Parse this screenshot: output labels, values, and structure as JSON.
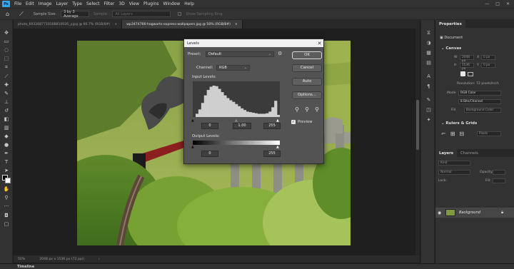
{
  "app": {
    "logo_text": "Ps"
  },
  "menu": [
    "File",
    "Edit",
    "Image",
    "Layer",
    "Type",
    "Select",
    "Filter",
    "3D",
    "View",
    "Plugins",
    "Window",
    "Help"
  ],
  "window_controls": [
    "—",
    "□",
    "✕"
  ],
  "options_bar": {
    "sample_size_label": "Sample Size:",
    "sample_size_value": "3 by 3 Average",
    "sample_label": "Sample:",
    "sample_value": "All Layers",
    "show_ring_label": "Show Sampling Ring"
  },
  "document_tabs": [
    {
      "title": "photo_6032687710188810026_y.jpg @ 66.7% (RGB/8#)",
      "close": "×",
      "active": false
    },
    {
      "title": "wp3474766-hogwarts-express-wallpapers.jpg @ 50% (RGB/8#)",
      "close": "×",
      "active": true
    }
  ],
  "status_bar": {
    "zoom": "50%",
    "doc_info": "2048 px x 1536 px (72 ppi)",
    "arrow": "›"
  },
  "timeline": {
    "label": "Timeline"
  },
  "levels": {
    "title": "Levels",
    "close": "✕",
    "preset_label": "Preset:",
    "preset_value": "Default",
    "channel_label": "Channel:",
    "channel_value": "RGB",
    "input_levels_label": "Input Levels:",
    "input_black": "0",
    "input_gamma": "1.00",
    "input_white": "255",
    "output_levels_label": "Output Levels:",
    "output_black": "0",
    "output_white": "255",
    "buttons": {
      "ok": "OK",
      "cancel": "Cancel",
      "auto": "Auto",
      "options": "Options..."
    },
    "preview_label": "Preview",
    "preview_checked": true
  },
  "properties_panel": {
    "tab": "Properties",
    "kind": "Document",
    "canvas_title": "Canvas",
    "w_label": "W",
    "w_value": "2048 px",
    "h_label": "H",
    "h_value": "1536 px",
    "x_label": "X",
    "x_value": "0 px",
    "y_label": "Y",
    "y_value": "0 px",
    "resolution": "Resolution: 72 pixels/inch",
    "mode_label": "Mode",
    "mode_value": "RGB Color",
    "depth_value": "8 Bits/Channel",
    "fill_label": "Fill",
    "fill_value": "Background Color",
    "rulers_title": "Rulers & Grids",
    "ruler_units": "Pixels"
  },
  "layers_panel": {
    "tabs": [
      "Layers",
      "Channels"
    ],
    "search_placeholder": "Kind",
    "blend_mode": "Normal",
    "opacity_label": "Opacity:",
    "lock_label": "Lock:",
    "fill_label": "Fill:",
    "layer_name": "Background"
  },
  "histogram": {
    "bins": [
      0,
      6,
      14,
      26,
      40,
      50,
      56,
      58,
      57,
      52,
      46,
      40,
      35,
      31,
      28,
      24,
      20,
      16,
      13,
      10,
      9,
      8,
      7,
      6,
      6,
      6,
      7,
      10,
      18,
      30,
      4
    ],
    "max": 58
  }
}
